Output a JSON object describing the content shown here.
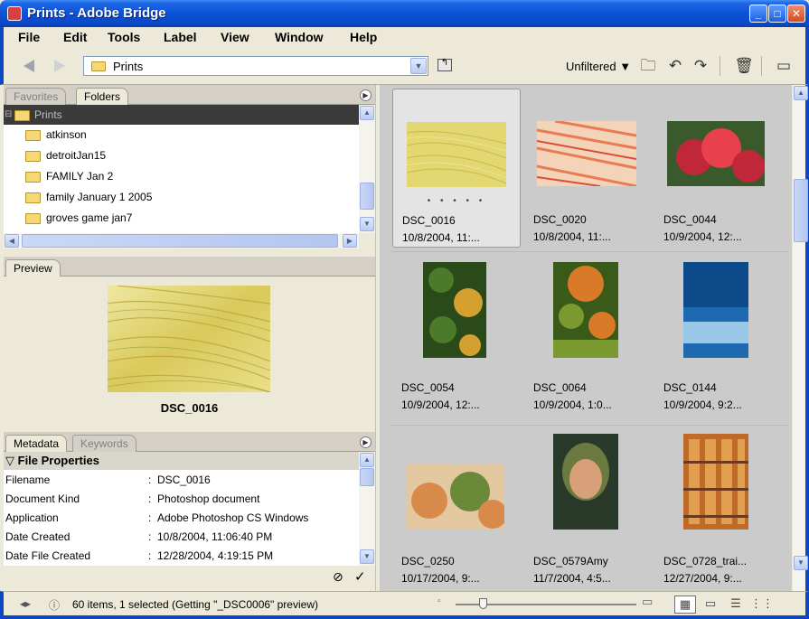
{
  "window": {
    "title": "Prints - Adobe Bridge",
    "controls": {
      "minimize": "_",
      "maximize": "□",
      "close": "✕"
    }
  },
  "menu": [
    "File",
    "Edit",
    "Tools",
    "Label",
    "View",
    "Window",
    "Help"
  ],
  "toolbar": {
    "path": "Prints",
    "filter": "Unfiltered ▼",
    "icons": [
      "back-arrow-icon",
      "forward-arrow-icon",
      "up-folder-icon",
      "new-folder-icon",
      "rotate-ccw-icon",
      "rotate-cw-icon",
      "trash-icon",
      "compact-mode-icon"
    ]
  },
  "left": {
    "tabs": {
      "favorites": "Favorites",
      "folders": "Folders"
    },
    "folders": [
      {
        "label": "Prints",
        "selected": true
      },
      {
        "label": "atkinson"
      },
      {
        "label": "detroitJan15"
      },
      {
        "label": "FAMILY Jan 2"
      },
      {
        "label": "family January 1 2005"
      },
      {
        "label": "groves game jan7"
      }
    ],
    "preview": {
      "tab": "Preview",
      "name": "DSC_0016"
    },
    "metadata": {
      "tabs": {
        "metadata": "Metadata",
        "keywords": "Keywords"
      },
      "section": "File Properties",
      "rows": [
        {
          "k": "Filename",
          "v": "DSC_0016"
        },
        {
          "k": "Document Kind",
          "v": "Photoshop document"
        },
        {
          "k": "Application",
          "v": "Adobe Photoshop CS Windows"
        },
        {
          "k": "Date Created",
          "v": "10/8/2004, 11:06:40 PM"
        },
        {
          "k": "Date File Created",
          "v": "12/28/2004, 4:19:15 PM"
        }
      ],
      "separator": ":"
    }
  },
  "thumbs": [
    {
      "name": "DSC_0016",
      "date": "10/8/2004, 11:...",
      "stars": "• • • • •",
      "selected": true,
      "colors": [
        "#e2d770",
        "#c9b948",
        "#f0e89a"
      ]
    },
    {
      "name": "DSC_0020",
      "date": "10/8/2004, 11:...",
      "colors": [
        "#e87a54",
        "#f4d4b8",
        "#d94c3a"
      ]
    },
    {
      "name": "DSC_0044",
      "date": "10/9/2004, 12:...",
      "colors": [
        "#c0283a",
        "#e8404c",
        "#3a5a2c"
      ]
    },
    {
      "name": "DSC_0054",
      "date": "10/9/2004, 12:...",
      "colors": [
        "#4a7a2a",
        "#d4a030",
        "#2a4a1a"
      ]
    },
    {
      "name": "DSC_0064",
      "date": "10/9/2004, 1:0...",
      "colors": [
        "#d87a28",
        "#7a9a30",
        "#3a5a1a"
      ]
    },
    {
      "name": "DSC_0144",
      "date": "10/9/2004, 9:2...",
      "colors": [
        "#1e6ab0",
        "#9ac8ea",
        "#0c4a8a"
      ]
    },
    {
      "name": "DSC_0250",
      "date": "10/17/2004, 9:...",
      "colors": [
        "#d88a4a",
        "#6a8a3a",
        "#e4c8a0"
      ]
    },
    {
      "name": "DSC_0579Amy",
      "date": "11/7/2004, 4:5...",
      "colors": [
        "#2a3a2a",
        "#d8a078",
        "#6a7a40"
      ]
    },
    {
      "name": "DSC_0728_trai...",
      "date": "12/27/2004, 9:...",
      "colors": [
        "#c06a2a",
        "#e0a050",
        "#6a3a1a"
      ]
    }
  ],
  "status": {
    "text": "60 items, 1 selected (Getting \"_DSC0006\" preview)",
    "thumb_size": 0.15
  }
}
